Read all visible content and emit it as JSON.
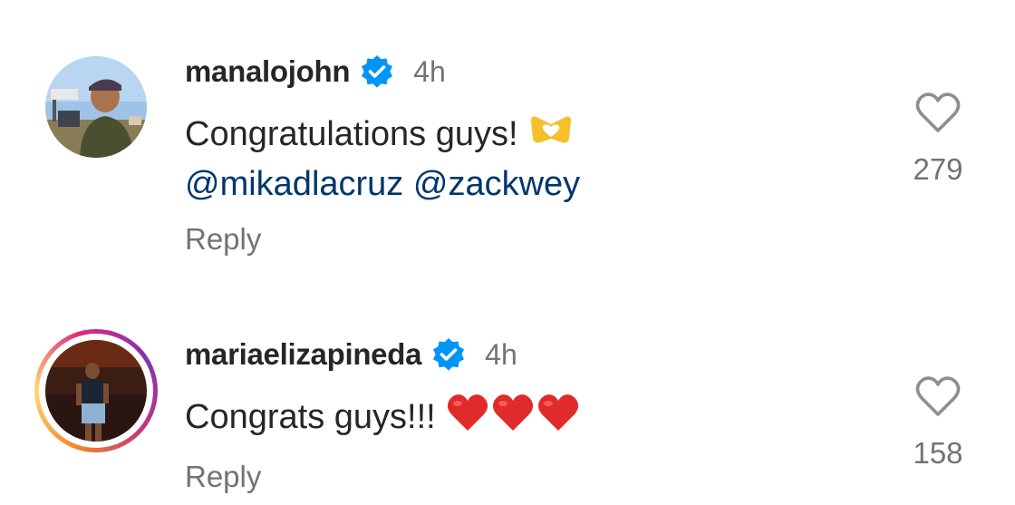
{
  "comments": [
    {
      "username": "manalojohn",
      "verified": true,
      "time": "4h",
      "text": "Congratulations guys!",
      "emoji": "heart-hands",
      "mentions": [
        "@mikadlacruz",
        "@zackwey"
      ],
      "reply_label": "Reply",
      "likes": "279",
      "story_ring": false
    },
    {
      "username": "mariaelizapineda",
      "verified": true,
      "time": "4h",
      "text": "Congrats guys!!!",
      "emoji": "red-heart x3",
      "reply_label": "Reply",
      "likes": "158",
      "story_ring": true
    }
  ],
  "colors": {
    "verified_blue": "#0095f6",
    "mention": "#00376b",
    "secondary_text": "#737373",
    "primary_text": "#262626"
  }
}
